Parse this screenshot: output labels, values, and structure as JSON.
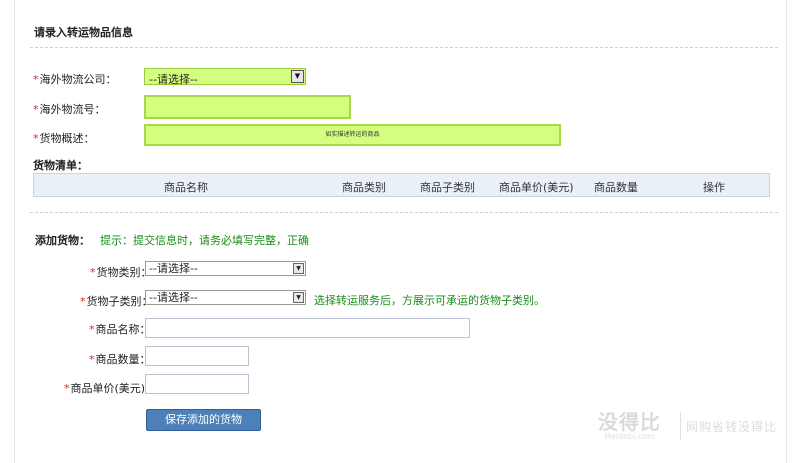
{
  "logistics_info": {
    "title": "请录入转运物品信息",
    "company_label": "海外物流公司：",
    "company_value": "--请选择--",
    "tracking_label": "海外物流号：",
    "tracking_value": "",
    "description_label": "货物概述：",
    "description_value": "如实描述转运的商品"
  },
  "cargo_list": {
    "title": "货物清单：",
    "columns": [
      "商品名称",
      "商品类别",
      "商品子类别",
      "商品单价(美元)",
      "商品数量",
      "操作"
    ]
  },
  "add_cargo": {
    "title": "添加货物：",
    "hint": "提示：提交信息时，请务必填写完整，正确",
    "category_label": "货物类别：",
    "category_value": "--请选择--",
    "subcategory_label": "货物子类别：",
    "subcategory_value": "--请选择--",
    "subcategory_hint": "选择转运服务后，方展示可承运的货物子类别。",
    "name_label": "商品名称：",
    "quantity_label": "商品数量：",
    "price_label": "商品单价(美元)：",
    "save_button": "保存添加的货物"
  },
  "required_mark": "*",
  "watermark": {
    "brand": "没得比",
    "domain": "Meidebi.com",
    "slogan": "网购省钱没得比"
  },
  "colors": {
    "highlight": "#d4ff7e",
    "hint_green": "#1a8c1a",
    "button_blue": "#4d7fb9",
    "required_red": "#e02020",
    "table_header_bg": "#eaf0f8"
  },
  "icons": {
    "dropdown": "chevron-down-icon"
  }
}
